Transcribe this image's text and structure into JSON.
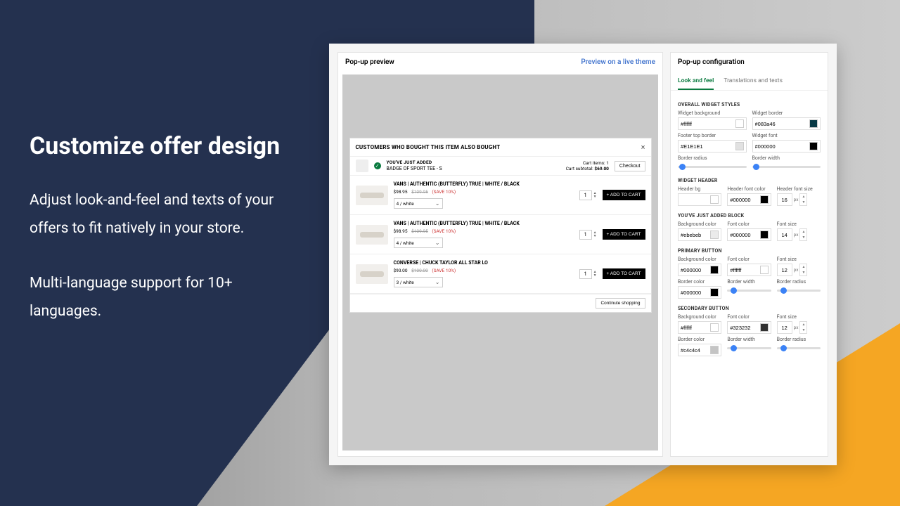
{
  "hero": {
    "title": "Customize offer design",
    "p1": "Adjust look-and-feel and texts of your offers to fit natively in your store.",
    "p2": "Multi-language support for 10+ languages."
  },
  "preview": {
    "title": "Pop-up preview",
    "live_link": "Preview on a live theme",
    "popup_title": "CUSTOMERS WHO BOUGHT THIS ITEM ALSO BOUGHT",
    "close": "×",
    "just_added_label": "YOU'VE JUST ADDED",
    "just_added_product": "BADGE OF SPORT TEE - S",
    "cart_items_label": "Cart items:",
    "cart_items": "1",
    "cart_subtotal_label": "Cart subtotal:",
    "cart_subtotal": "$69.00",
    "checkout": "Checkout",
    "continue": "Continute shopping",
    "addcart": "+ ADD TO CART",
    "products": [
      {
        "name": "VANS | AUTHENTIC (BUTTERFLY) TRUE | WHITE / BLACK",
        "price": "$98.95",
        "was": "$109.95",
        "save": "(SAVE 10%)",
        "variant": "4 / white",
        "qty": "1"
      },
      {
        "name": "VANS | AUTHENTIC (BUTTERFLY) TRUE | WHITE / BLACK",
        "price": "$98.95",
        "was": "$109.95",
        "save": "(SAVE 10%)",
        "variant": "4 / white",
        "qty": "1"
      },
      {
        "name": "CONVERSE | CHUCK TAYLOR ALL STAR LO",
        "price": "$90.00",
        "was": "$100.00",
        "save": "(SAVE 10%)",
        "variant": "3 / white",
        "qty": "1"
      }
    ]
  },
  "config": {
    "title": "Pop-up configuration",
    "tabs": {
      "a": "Look and feel",
      "b": "Translations and texts"
    },
    "sections": {
      "overall": "OVERALL WIDGET STYLES",
      "header": "WIDGET HEADER",
      "just_added": "YOU'VE JUST ADDED BLOCK",
      "primary": "PRIMARY BUTTON",
      "secondary": "SECONDARY BUTTON"
    },
    "labels": {
      "widget_bg": "Widget background",
      "widget_border": "Widget border",
      "footer_top": "Footer top border",
      "widget_font": "Widget font",
      "border_radius": "Border radius",
      "border_width": "Border width",
      "header_bg": "Header bg",
      "header_font_color": "Header font color",
      "header_font_size": "Header font size",
      "bg_color": "Background color",
      "font_color": "Font color",
      "font_size": "Font size",
      "border_color": "Border color",
      "px": "px"
    },
    "values": {
      "widget_bg": "#ffffff",
      "widget_border": "#083a46",
      "footer_top": "#E1E1E1",
      "widget_font": "#000000",
      "header_bg": "",
      "header_font_color": "#000000",
      "header_font_size": "16",
      "ja_bg": "#ebebeb",
      "ja_font": "#000000",
      "ja_size": "14",
      "pb_bg": "#000000",
      "pb_font": "#ffffff",
      "pb_size": "12",
      "pb_border": "#000000",
      "sb_bg": "#ffffff",
      "sb_font": "#323232",
      "sb_size": "12",
      "sb_border": "#c4c4c4"
    },
    "swatches": {
      "widget_bg": "#ffffff",
      "widget_border": "#083a46",
      "footer_top": "#e1e1e1",
      "widget_font": "#000000",
      "header_bg": "#ffffff",
      "header_font_color": "#000000",
      "ja_bg": "#ebebeb",
      "ja_font": "#000000",
      "pb_bg": "#000000",
      "pb_font": "#ffffff",
      "pb_border": "#000000",
      "sb_bg": "#ffffff",
      "sb_font": "#323232",
      "sb_border": "#c4c4c4"
    },
    "sliders": {
      "overall_radius": 2,
      "overall_width": 2,
      "pb_width": 8,
      "pb_radius": 8,
      "sb_width": 8,
      "sb_radius": 8
    }
  }
}
